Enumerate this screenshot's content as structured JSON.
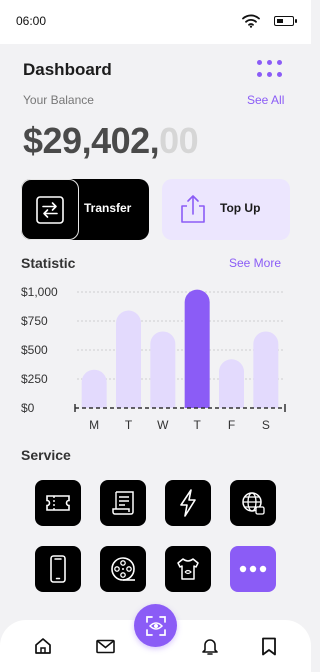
{
  "status_bar": {
    "time": "06:00"
  },
  "header": {
    "title": "Dashboard"
  },
  "balance": {
    "label": "Your Balance",
    "see_all": "See All",
    "amount_main": "$29,402,",
    "amount_cents": "00"
  },
  "actions": {
    "transfer_label": "Transfer",
    "topup_label": "Top Up"
  },
  "statistic": {
    "title": "Statistic",
    "see_more": "See More"
  },
  "chart_data": {
    "type": "bar",
    "categories": [
      "M",
      "T",
      "W",
      "T",
      "F",
      "S"
    ],
    "values": [
      330,
      840,
      660,
      1020,
      420,
      660
    ],
    "highlight_index": 3,
    "yticks": [
      "$1,000",
      "$750",
      "$500",
      "$250",
      "$0"
    ],
    "ylim": [
      0,
      1000
    ],
    "grid": true,
    "colors": {
      "bar": "#e3dafd",
      "highlight": "#8b5cf6",
      "axis": "#333333",
      "grid": "#cfcfcf"
    }
  },
  "service": {
    "title": "Service",
    "items": [
      {
        "icon": "ticket-icon"
      },
      {
        "icon": "receipt-icon"
      },
      {
        "icon": "electricity-icon"
      },
      {
        "icon": "internet-icon"
      },
      {
        "icon": "mobile-icon"
      },
      {
        "icon": "film-reel-icon"
      },
      {
        "icon": "laundry-icon"
      },
      {
        "icon": "more-icon"
      }
    ]
  },
  "bottom_nav": {
    "items": [
      "home-icon",
      "mail-icon",
      "scan-icon",
      "bell-icon",
      "bookmark-icon"
    ]
  },
  "colors": {
    "accent": "#8b5cf6",
    "accent_light": "#ece6fe",
    "dark": "#000000",
    "background": "#f2f2f4"
  }
}
